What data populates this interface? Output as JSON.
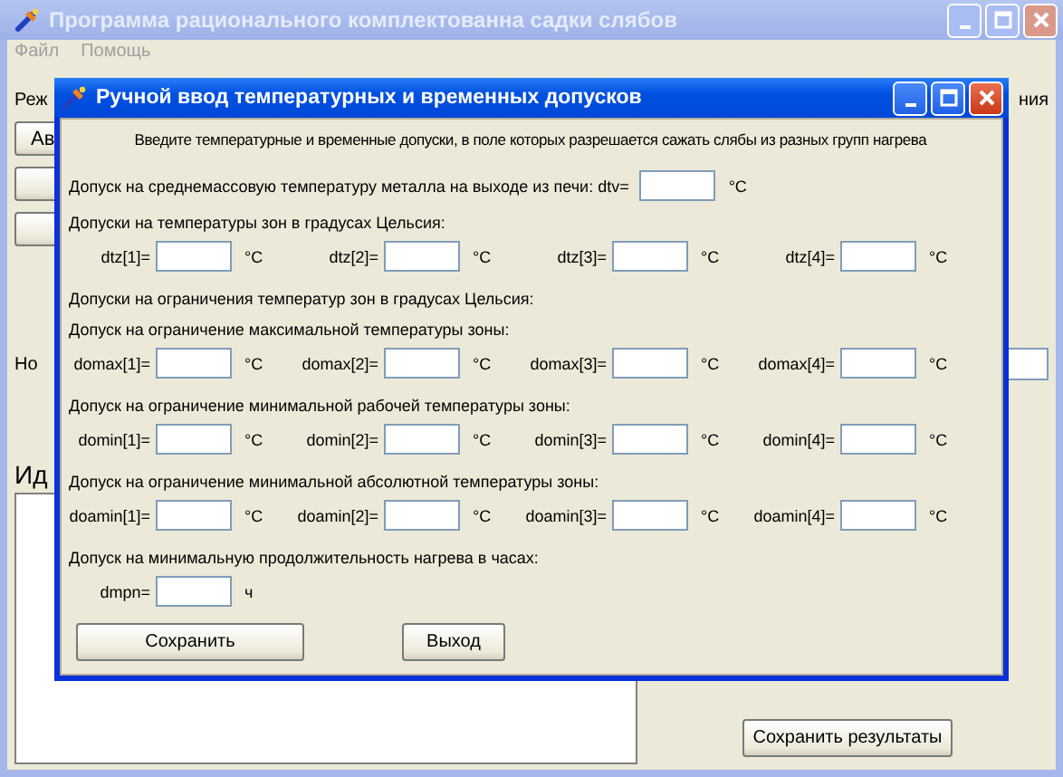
{
  "window": {
    "title": "Программа рационального комплектованна садки слябов",
    "menu": [
      "Файл",
      "Помощь"
    ]
  },
  "background": {
    "mode_label": "Реж",
    "mode_label_tail": "ния",
    "buttons": [
      {
        "label": "Ав"
      }
    ],
    "row_label": "Но",
    "section_title": "Ид",
    "save_button": "Сохранить результаты"
  },
  "dialog": {
    "title": "Ручной ввод температурных и временных допусков",
    "instruction": "Введите температурные и временные допуски, в поле которых разрешается сажать слябы из разных групп нагрева",
    "rows": [
      {
        "kind": "inline",
        "label": "Допуск на среднемассовую температуру металла на выходе из печи: dtv=",
        "unit": "°C"
      },
      {
        "kind": "text",
        "text": "Допуски на температуры зон в градусах Цельсия:"
      },
      {
        "kind": "fields",
        "fields": [
          {
            "label": "dtz[1]=",
            "unit": "°C"
          },
          {
            "label": "dtz[2]=",
            "unit": "°C"
          },
          {
            "label": "dtz[3]=",
            "unit": "°C"
          },
          {
            "label": "dtz[4]=",
            "unit": "°C"
          }
        ]
      },
      {
        "kind": "text",
        "text": "Допуски на ограничения температур зон в градусах Цельсия:"
      },
      {
        "kind": "text",
        "text": "Допуск на ограничение максимальной температуры зоны:"
      },
      {
        "kind": "fields",
        "fields": [
          {
            "label": "domax[1]=",
            "unit": "°C"
          },
          {
            "label": "domax[2]=",
            "unit": "°C"
          },
          {
            "label": "domax[3]=",
            "unit": "°C"
          },
          {
            "label": "domax[4]=",
            "unit": "°C"
          }
        ]
      },
      {
        "kind": "text",
        "text": "Допуск на ограничение минимальной рабочей температуры зоны:"
      },
      {
        "kind": "fields",
        "fields": [
          {
            "label": "domin[1]=",
            "unit": "°C"
          },
          {
            "label": "domin[2]=",
            "unit": "°C"
          },
          {
            "label": "domin[3]=",
            "unit": "°C"
          },
          {
            "label": "domin[4]=",
            "unit": "°C"
          }
        ]
      },
      {
        "kind": "text",
        "text": "Допуск на ограничение минимальной абсолютной температуры зоны:"
      },
      {
        "kind": "fields",
        "fields": [
          {
            "label": "doamin[1]=",
            "unit": "°C"
          },
          {
            "label": "doamin[2]=",
            "unit": "°C"
          },
          {
            "label": "doamin[3]=",
            "unit": "°C"
          },
          {
            "label": "doamin[4]=",
            "unit": "°C"
          }
        ]
      },
      {
        "kind": "text",
        "text": "Допуск на минимальную продолжительность нагрева в часах:"
      },
      {
        "kind": "fields",
        "fields": [
          {
            "label": "dmpn=",
            "unit": "ч"
          }
        ]
      }
    ],
    "buttons": [
      {
        "label": "Сохранить",
        "kind": "wide"
      },
      {
        "label": "Выход",
        "kind": "narrow"
      }
    ]
  }
}
